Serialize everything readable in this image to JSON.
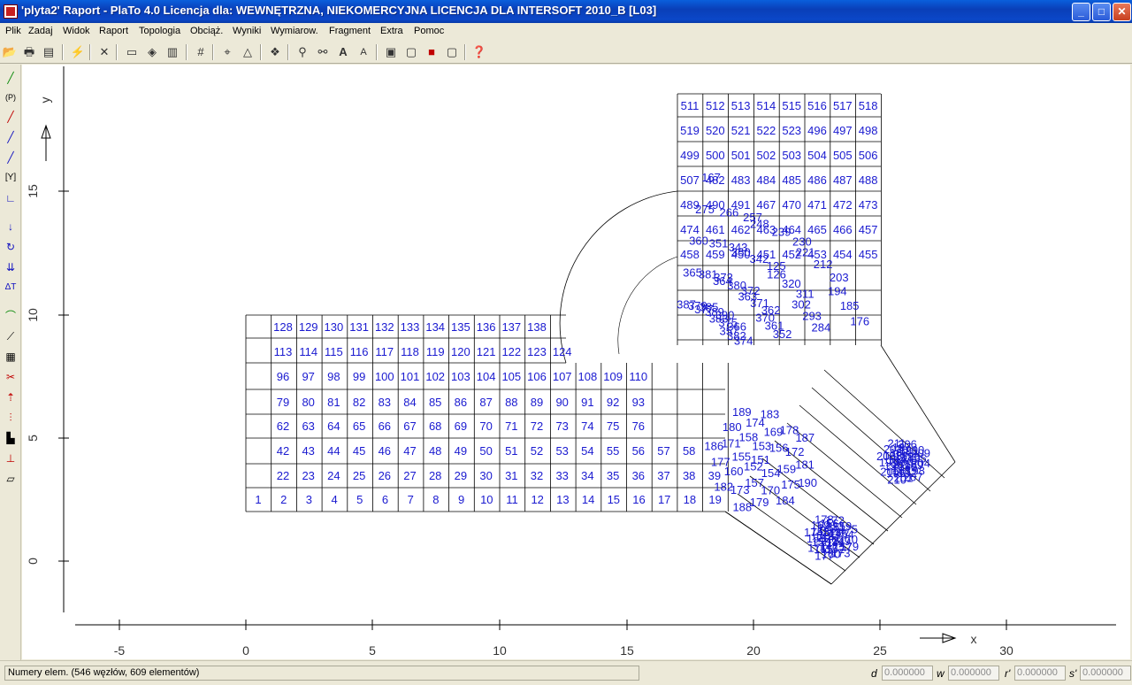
{
  "window": {
    "title": "'plyta2' Raport  - PlaTo 4.0  Licencja dla: WEWNĘTRZNA, NIEKOMERCYJNA LICENCJA DLA INTERSOFT 2010_B [L03]",
    "min_label": "_",
    "max_label": "□",
    "close_label": "✕"
  },
  "menu": [
    "Plik",
    "Zadaj",
    "Widok",
    "Raport",
    "Topologia",
    "Obciąż.",
    "Wyniki",
    "Wymiarow.",
    "Fragment",
    "Extra",
    "Pomoc"
  ],
  "toolbar_icons": [
    "open-icon",
    "print-icon",
    "print-preview-icon",
    "axes-icon",
    "delete-icon",
    "display-icon",
    "layers-icon",
    "library-icon",
    "grid-icon",
    "node-numbers-icon",
    "dimension-icon",
    "render-icon",
    "zoom-icon",
    "zoom-window-icon",
    "font-larger-icon",
    "font-smaller-icon",
    "view-3d-icon",
    "view-front-icon",
    "view-side-icon",
    "view-top-icon",
    "help-icon"
  ],
  "left_tools": [
    "line-tool-icon",
    "panel-tool-icon",
    "node-tool-icon",
    "support-tool-icon",
    "beam-tool-icon",
    "y-tool-icon",
    "axis-tool-icon",
    "force-tool-icon",
    "moment-tool-icon",
    "load-tool-icon",
    "temperature-tool-icon",
    "curve-tool-icon",
    "ruler-tool-icon",
    "measure-tool-icon",
    "cut-tool-icon",
    "spring-tool-icon",
    "distributed-tool-icon",
    "wall-tool-icon",
    "pin-tool-icon",
    "eraser-tool-icon"
  ],
  "axes": {
    "x_label": "x",
    "y_label": "y",
    "x_ticks": [
      "-5",
      "0",
      "5",
      "10",
      "15",
      "20",
      "25",
      "30"
    ],
    "y_ticks": [
      "15",
      "10",
      "5",
      "0"
    ]
  },
  "bottom_row_numbers": [
    "1",
    "2",
    "3",
    "4",
    "5",
    "6",
    "7",
    "8",
    "9",
    "10",
    "11",
    "12",
    "13",
    "14",
    "15",
    "16",
    "17",
    "18",
    "19"
  ],
  "row2_numbers": [
    "22",
    "23",
    "24",
    "25",
    "26",
    "27",
    "28",
    "29",
    "30",
    "31",
    "32",
    "33",
    "34",
    "35",
    "36",
    "37",
    "38",
    "39"
  ],
  "row3_numbers": [
    "42",
    "43",
    "44",
    "45",
    "46",
    "47",
    "48",
    "49",
    "50",
    "51",
    "52",
    "53",
    "54",
    "55",
    "56",
    "57",
    "58"
  ],
  "row4_numbers": [
    "62",
    "63",
    "64",
    "65",
    "66",
    "67",
    "68",
    "69",
    "70",
    "71",
    "72",
    "73",
    "74",
    "75",
    "76"
  ],
  "row5_numbers": [
    "79",
    "80",
    "81",
    "82",
    "83",
    "84",
    "85",
    "86",
    "87",
    "88",
    "89",
    "90",
    "91",
    "92",
    "93"
  ],
  "row6_numbers": [
    "96",
    "97",
    "98",
    "99",
    "100",
    "101",
    "102",
    "103",
    "104",
    "105",
    "106",
    "107",
    "108",
    "109",
    "110"
  ],
  "row7_numbers": [
    "113",
    "114",
    "115",
    "116",
    "117",
    "118",
    "119",
    "120",
    "121",
    "122",
    "123",
    "124"
  ],
  "row8_numbers": [
    "128",
    "129",
    "130",
    "131",
    "132",
    "133",
    "134",
    "135",
    "136",
    "137",
    "138"
  ],
  "right_block_numbers": [
    "511",
    "512",
    "513",
    "514",
    "515",
    "516",
    "517",
    "518",
    "519",
    "520",
    "521",
    "522",
    "523",
    "496",
    "497",
    "498",
    "499",
    "500",
    "501",
    "502",
    "503",
    "504",
    "505",
    "506",
    "507",
    "482",
    "483",
    "484",
    "485",
    "486",
    "487",
    "488",
    "489",
    "490",
    "491",
    "467",
    "470",
    "471",
    "472",
    "473",
    "474",
    "461",
    "462",
    "463",
    "464",
    "465",
    "466",
    "457",
    "458",
    "459",
    "450",
    "451",
    "452",
    "453",
    "454",
    "455"
  ],
  "arc_numbers": [
    "387",
    "379",
    "385",
    "377",
    "389",
    "390",
    "383",
    "375",
    "366",
    "357",
    "382",
    "374",
    "365",
    "381",
    "373",
    "364",
    "380",
    "372",
    "363",
    "371",
    "362",
    "370",
    "361",
    "352",
    "360",
    "351",
    "343",
    "350",
    "342",
    "125",
    "126",
    "320",
    "311",
    "302",
    "293",
    "284",
    "275",
    "266",
    "257",
    "248",
    "239",
    "230",
    "221",
    "212",
    "203",
    "194",
    "185",
    "176",
    "167"
  ],
  "blob_numbers": [
    "141",
    "142",
    "143",
    "144",
    "145",
    "146",
    "147",
    "148",
    "149",
    "150",
    "151",
    "152",
    "153",
    "154",
    "155",
    "156",
    "157",
    "158",
    "159",
    "160",
    "169",
    "170",
    "171",
    "172",
    "173",
    "174",
    "175",
    "177",
    "178",
    "179",
    "180",
    "181",
    "182",
    "183",
    "184",
    "186",
    "187",
    "188",
    "189",
    "190",
    "191",
    "192",
    "193",
    "195",
    "196",
    "197",
    "198",
    "199",
    "200",
    "201",
    "202",
    "204",
    "205",
    "206",
    "207",
    "208",
    "209",
    "210",
    "211"
  ],
  "status": {
    "text": "Numery elem. (546 węzłów, 609 elementów)",
    "d_label": "d",
    "d_value": "0.000000",
    "w_label": "w",
    "w_value": "0.000000",
    "r_label": "r'",
    "r_value": "0.000000",
    "s_label": "s'",
    "s_value": "0.000000"
  },
  "colors": {
    "mesh": "#1a1ad0",
    "grid": "#000000",
    "titlebar": "#0A3FB8"
  }
}
